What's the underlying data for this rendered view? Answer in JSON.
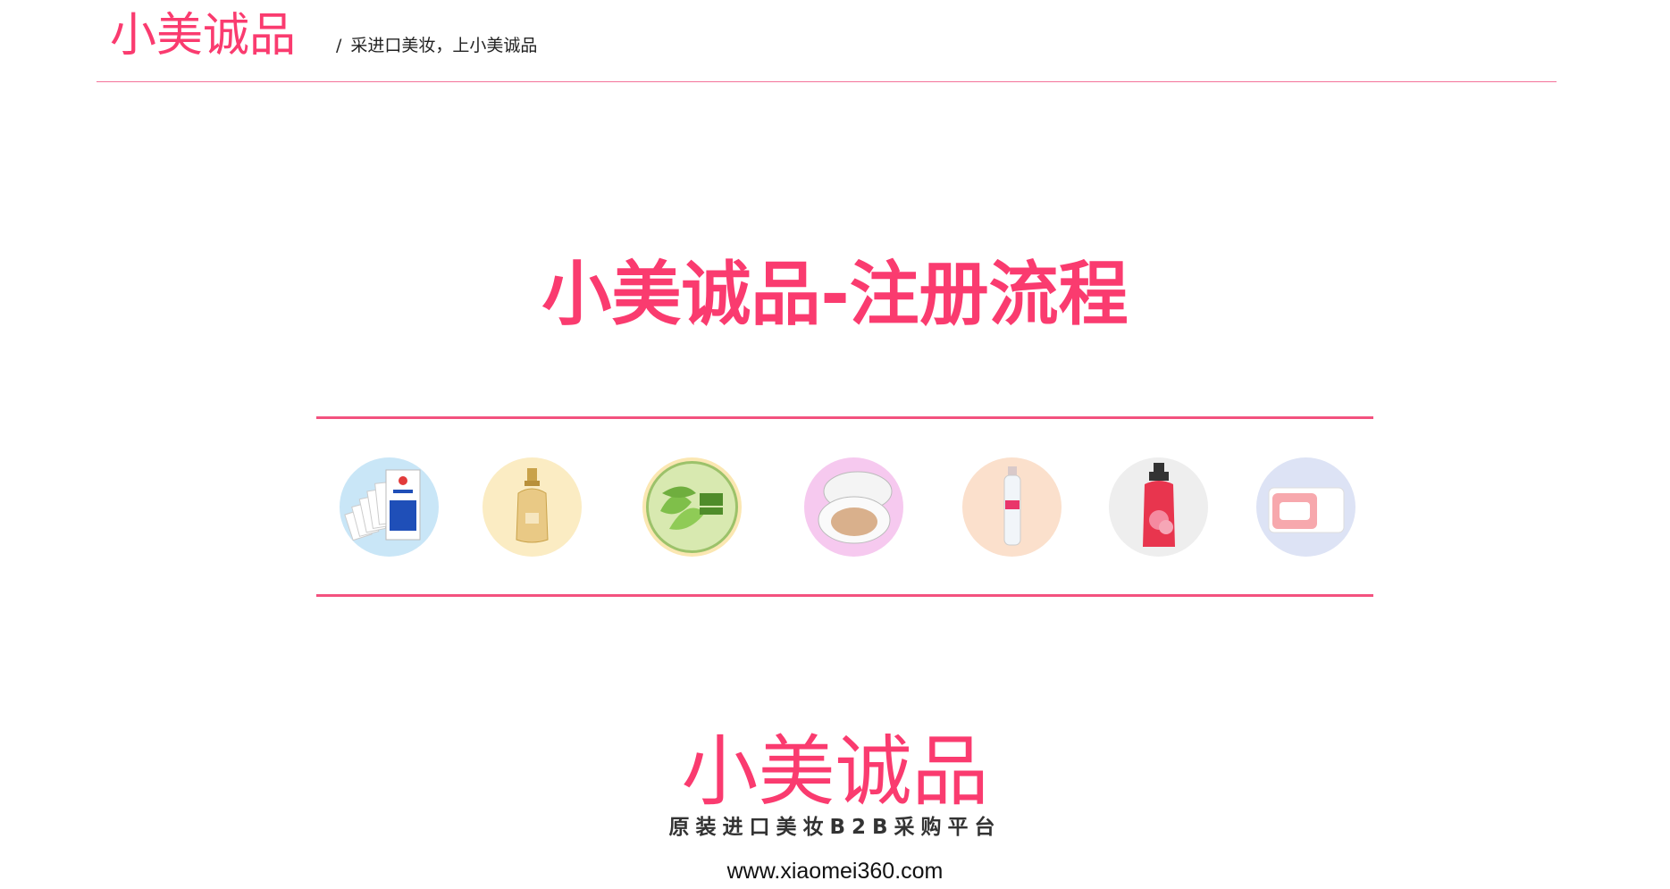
{
  "header": {
    "logo_text": "小美诚品",
    "slash": "/",
    "slogan": "采进口美妆，上小美诚品"
  },
  "main": {
    "title": "小美诚品-注册流程"
  },
  "products": [
    {
      "icon": "mask-pack-icon",
      "bg": "#c9e6f7"
    },
    {
      "icon": "serum-bottle-icon",
      "bg": "#fbecc3"
    },
    {
      "icon": "aloe-gel-jar-icon",
      "bg": "#fbe7b2"
    },
    {
      "icon": "cushion-compact-icon",
      "bg": "#f6c9ef"
    },
    {
      "icon": "spray-bottle-icon",
      "bg": "#fbe0cc"
    },
    {
      "icon": "body-wash-bottle-icon",
      "bg": "#eeeeee"
    },
    {
      "icon": "cotton-towel-pack-icon",
      "bg": "#dde3f5"
    }
  ],
  "footer": {
    "logo_text": "小美诚品",
    "sub_slogan": "原装进口美妆B2B采购平台",
    "website": "www.xiaomei360.com"
  },
  "colors": {
    "brand": "#fa3b6f",
    "rule": "#f3527f"
  }
}
